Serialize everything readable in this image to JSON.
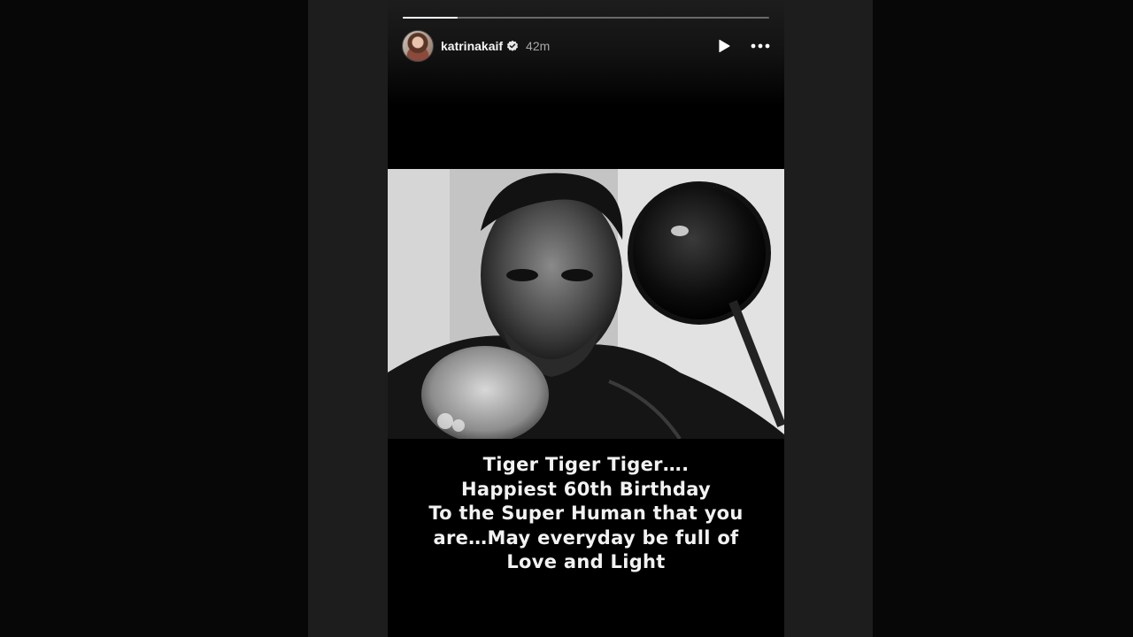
{
  "story": {
    "progress": 0.15,
    "author": {
      "username": "katrinakaif",
      "verified": true,
      "time_ago": "42m"
    },
    "controls": {
      "play_icon": "play-icon",
      "more_icon": "more-options-icon"
    },
    "media": {
      "type": "black-and-white photo"
    },
    "caption_lines": [
      "Tiger Tiger Tiger….",
      "Happiest 60th Birthday",
      "To the Super Human that you",
      "are…May everyday be full of",
      "Love and Light"
    ]
  },
  "colors": {
    "backdrop": "#070707",
    "panel": "#1d1d1d",
    "story_bg": "#000000",
    "text_primary": "#f5f5f5",
    "text_secondary": "#a8a8a8",
    "progress_fill": "#ffffff"
  }
}
